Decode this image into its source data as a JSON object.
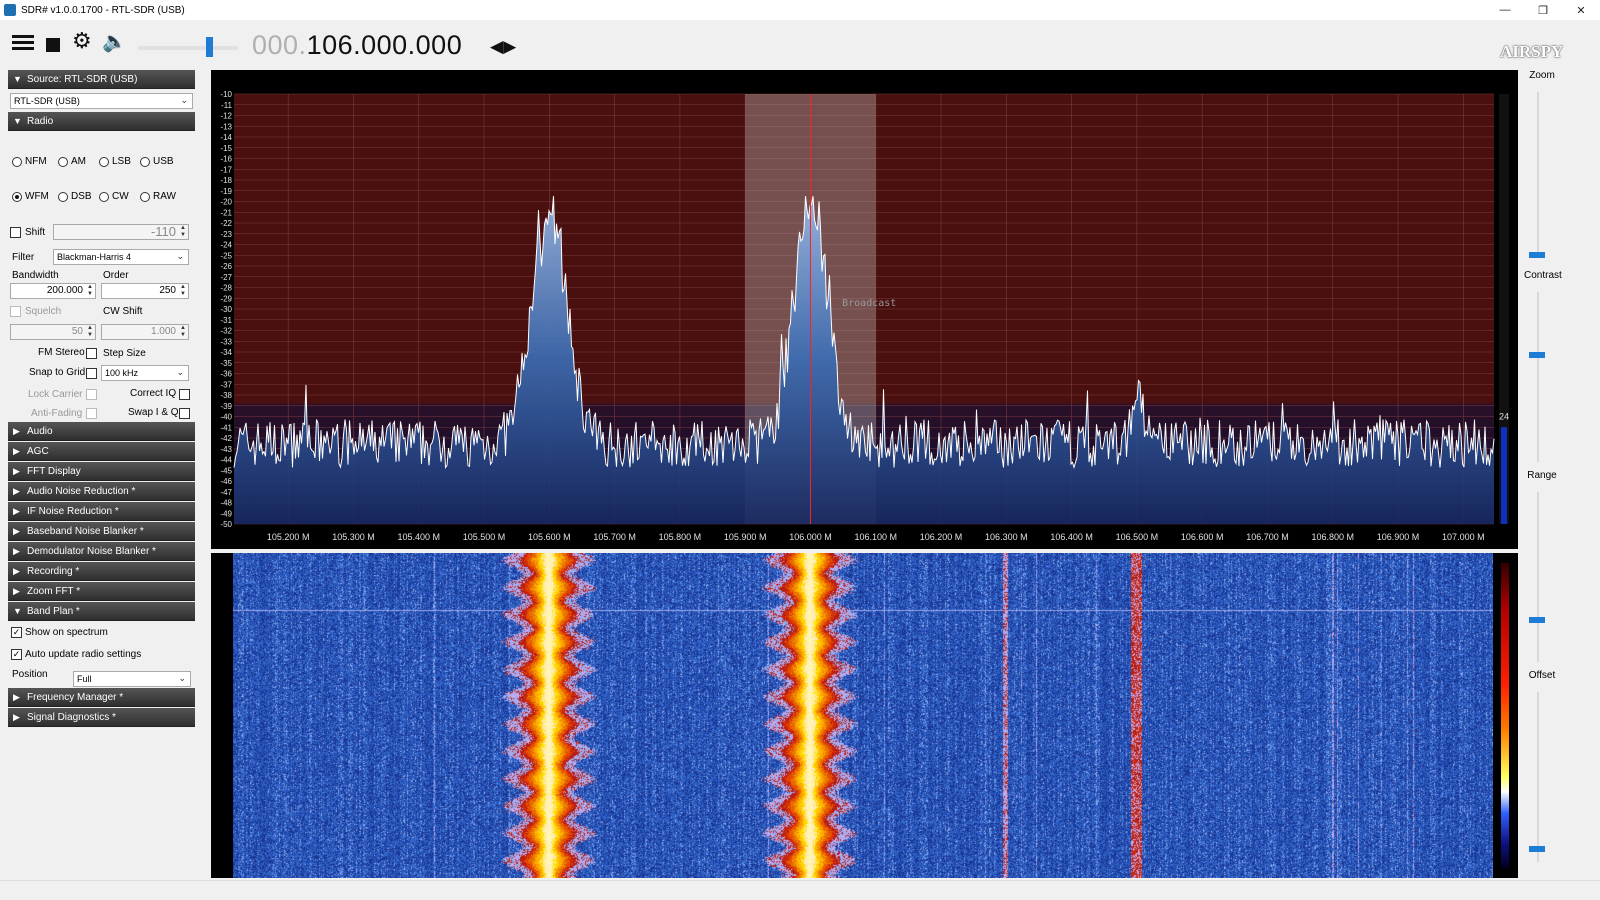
{
  "window": {
    "title": "SDR# v1.0.0.1700 - RTL-SDR (USB)"
  },
  "toolbar": {
    "frequency_prefix": "000.",
    "frequency_main": "106.000.000",
    "brand": "AIRSPY",
    "volume_level": 0.68
  },
  "sidebar": {
    "source": {
      "header": "Source: RTL-SDR (USB)",
      "device": "RTL-SDR (USB)"
    },
    "radio": {
      "header": "Radio",
      "modes": [
        "NFM",
        "AM",
        "LSB",
        "USB",
        "WFM",
        "DSB",
        "CW",
        "RAW"
      ],
      "selected_mode": "WFM",
      "shift_label": "Shift",
      "shift_value": "-110",
      "filter_label": "Filter",
      "filter_value": "Blackman-Harris 4",
      "bandwidth_label": "Bandwidth",
      "bandwidth_value": "200.000",
      "order_label": "Order",
      "order_value": "250",
      "squelch_label": "Squelch",
      "squelch_value": "50",
      "cw_shift_label": "CW Shift",
      "cw_shift_value": "1.000",
      "fm_stereo_label": "FM Stereo",
      "step_size_label": "Step Size",
      "snap_label": "Snap to Grid",
      "step_value": "100 kHz",
      "lock_carrier_label": "Lock Carrier",
      "correct_iq_label": "Correct IQ",
      "anti_fading_label": "Anti-Fading",
      "swap_iq_label": "Swap I & Q"
    },
    "collapsed_sections": [
      "Audio",
      "AGC",
      "FFT Display",
      "Audio Noise Reduction *",
      "IF Noise Reduction *",
      "Baseband Noise Blanker *",
      "Demodulator Noise Blanker *",
      "Recording *",
      "Zoom FFT *"
    ],
    "band_plan": {
      "header": "Band Plan *",
      "show_on_spectrum": "Show on spectrum",
      "auto_update": "Auto update radio settings",
      "position_label": "Position",
      "position_value": "Full"
    },
    "bottom_sections": [
      "Frequency Manager *",
      "Signal Diagnostics *"
    ]
  },
  "spectrum": {
    "y_ticks": [
      "-10",
      "-11",
      "-12",
      "-13",
      "-14",
      "-15",
      "-16",
      "-17",
      "-18",
      "-19",
      "-20",
      "-21",
      "-22",
      "-23",
      "-24",
      "-25",
      "-26",
      "-27",
      "-28",
      "-29",
      "-30",
      "-31",
      "-32",
      "-33",
      "-34",
      "-35",
      "-36",
      "-37",
      "-38",
      "-39",
      "-40",
      "-41",
      "-42",
      "-43",
      "-44",
      "-45",
      "-46",
      "-47",
      "-48",
      "-49",
      "-50"
    ],
    "x_ticks": [
      "105.200 M",
      "105.300 M",
      "105.400 M",
      "105.500 M",
      "105.600 M",
      "105.700 M",
      "105.800 M",
      "105.900 M",
      "106.000 M",
      "106.100 M",
      "106.200 M",
      "106.300 M",
      "106.400 M",
      "106.500 M",
      "106.600 M",
      "106.700 M",
      "106.800 M",
      "106.900 M",
      "107.000 M"
    ],
    "band_label": "Broadcast",
    "level_readout": "24",
    "signal_peaks_mhz": [
      105.6,
      106.0,
      106.5
    ],
    "colors": {
      "noise_bg": "#4a0f0f",
      "trace": "#ffffff",
      "fill": "#3a6db5",
      "tuned_line": "#ff2020"
    }
  },
  "right_controls": {
    "zoom_label": "Zoom",
    "contrast_label": "Contrast",
    "range_label": "Range",
    "offset_label": "Offset"
  }
}
